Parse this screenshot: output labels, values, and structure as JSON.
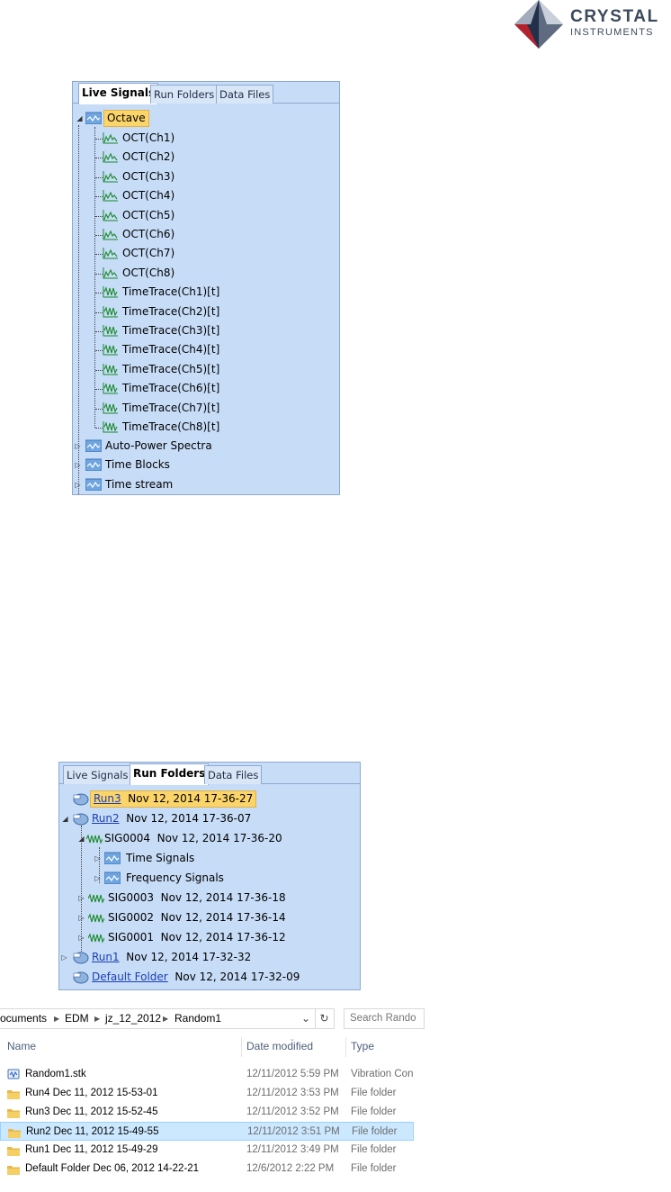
{
  "logo": {
    "line1": "CRYSTAL",
    "line2": "INSTRUMENTS"
  },
  "panel1": {
    "tabs": [
      "Live Signals",
      "Run Folders",
      "Data Files"
    ],
    "active_tab": "Live Signals",
    "root": "Octave",
    "octave_children": [
      "OCT(Ch1)",
      "OCT(Ch2)",
      "OCT(Ch3)",
      "OCT(Ch4)",
      "OCT(Ch5)",
      "OCT(Ch6)",
      "OCT(Ch7)",
      "OCT(Ch8)",
      "TimeTrace(Ch1)[t]",
      "TimeTrace(Ch2)[t]",
      "TimeTrace(Ch3)[t]",
      "TimeTrace(Ch4)[t]",
      "TimeTrace(Ch5)[t]",
      "TimeTrace(Ch6)[t]",
      "TimeTrace(Ch7)[t]",
      "TimeTrace(Ch8)[t]"
    ],
    "collapsed_groups": [
      "Auto-Power Spectra",
      "Time Blocks",
      "Time stream"
    ]
  },
  "panel2": {
    "tabs": [
      "Live Signals",
      "Run Folders",
      "Data Files"
    ],
    "active_tab": "Run Folders",
    "run3": {
      "name": "Run3",
      "date": "Nov 12, 2014 17-36-27"
    },
    "run2": {
      "name": "Run2",
      "date": "Nov 12, 2014 17-36-07"
    },
    "sig4": {
      "name": "SIG0004",
      "date": "Nov 12, 2014 17-36-20"
    },
    "sig4_children": [
      "Time Signals",
      "Frequency Signals"
    ],
    "sig3": {
      "name": "SIG0003",
      "date": "Nov 12, 2014 17-36-18"
    },
    "sig2": {
      "name": "SIG0002",
      "date": "Nov 12, 2014 17-36-14"
    },
    "sig1": {
      "name": "SIG0001",
      "date": "Nov 12, 2014 17-36-12"
    },
    "run1": {
      "name": "Run1",
      "date": "Nov 12, 2014 17-32-32"
    },
    "default_folder": {
      "name": "Default Folder",
      "date": "Nov 12, 2014 17-32-09"
    }
  },
  "explorer": {
    "breadcrumb": [
      "ocuments",
      "EDM",
      "jz_12_2012",
      "Random1"
    ],
    "search_placeholder": "Search Rando",
    "columns": [
      "Name",
      "Date modified",
      "Type"
    ],
    "rows": [
      {
        "name": "Random1.stk",
        "date": "12/11/2012 5:59 PM",
        "type": "Vibration Con",
        "icon": "vibration-file-icon"
      },
      {
        "name": "Run4 Dec 11, 2012 15-53-01",
        "date": "12/11/2012 3:53 PM",
        "type": "File folder",
        "icon": "folder-icon"
      },
      {
        "name": "Run3 Dec 11, 2012 15-52-45",
        "date": "12/11/2012 3:52 PM",
        "type": "File folder",
        "icon": "folder-icon"
      },
      {
        "name": "Run2 Dec 11, 2012 15-49-55",
        "date": "12/11/2012 3:51 PM",
        "type": "File folder",
        "icon": "folder-icon",
        "selected": true
      },
      {
        "name": "Run1 Dec 11, 2012 15-49-29",
        "date": "12/11/2012 3:49 PM",
        "type": "File folder",
        "icon": "folder-icon"
      },
      {
        "name": "Default Folder Dec 06, 2012 14-22-21",
        "date": "12/6/2012 2:22 PM",
        "type": "File folder",
        "icon": "folder-icon"
      }
    ]
  },
  "colors": {
    "panel_bg": "#c7dcf7",
    "selection": "#fbd46a",
    "link": "#1b3fb5",
    "signal_green": "#1a8a2a"
  }
}
